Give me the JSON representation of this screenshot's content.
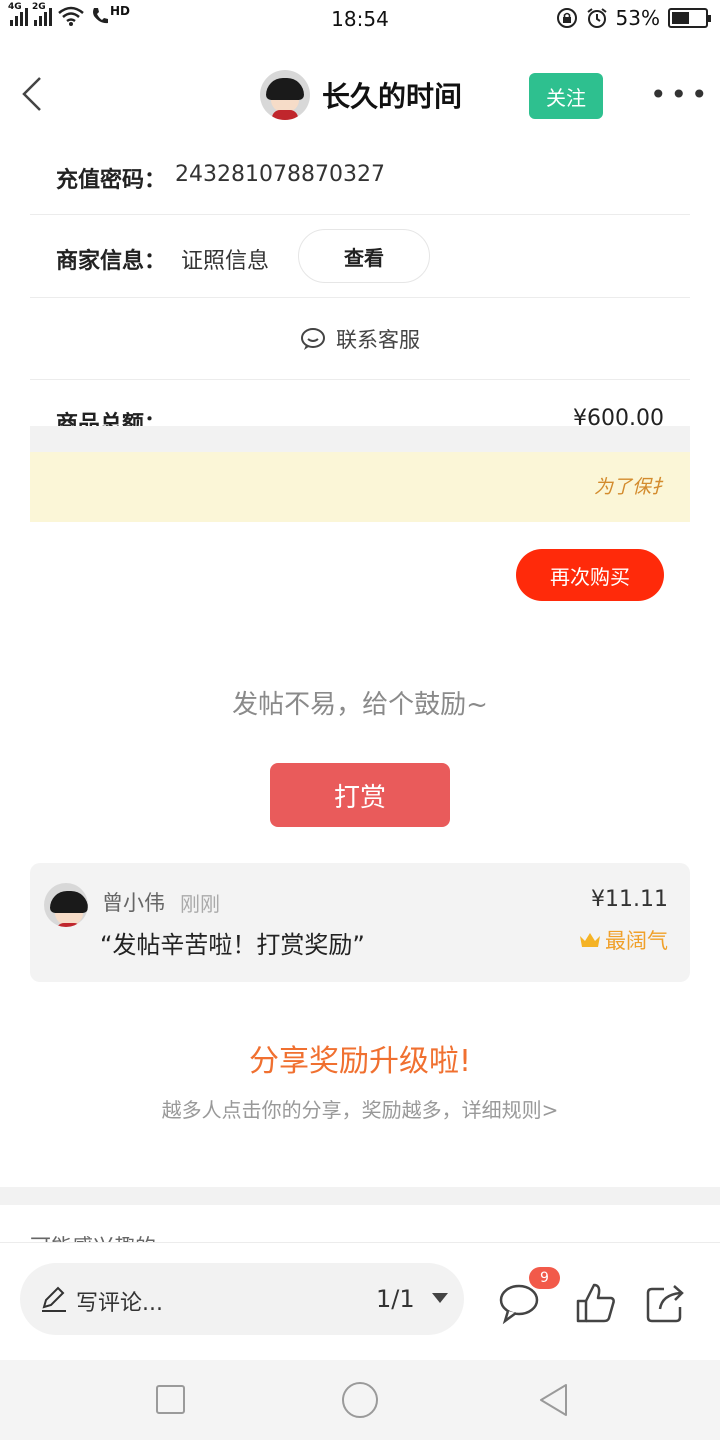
{
  "status_bar": {
    "net1": "4G",
    "net2": "2G",
    "hd": "HD",
    "time": "18:54",
    "battery_text": "53%",
    "battery_level": 0.53
  },
  "header": {
    "author_name": "长久的时间",
    "follow_label": "关注"
  },
  "order": {
    "recharge_label": "充值密码：",
    "recharge_value": "243281078870327",
    "merchant_label": "商家信息：",
    "merchant_value": "证照信息",
    "view_label": "查看",
    "service_label": "联系客服",
    "total_label": "商品总额：",
    "total_value": "¥600.00",
    "notice_text": "为了保扌",
    "rebuy_label": "再次购买"
  },
  "reward": {
    "prompt": "发帖不易，给个鼓励~",
    "button_label": "打赏",
    "tip": {
      "user": "曾小伟",
      "time": "刚刚",
      "message": "“发帖辛苦啦！打赏奖励”",
      "amount": "¥11.11",
      "badge": "最阔气"
    }
  },
  "share": {
    "title": "分享奖励升级啦!",
    "subtitle": "越多人点击你的分享，奖励越多，详细规则>"
  },
  "section": {
    "interest_title": "可能感兴趣的"
  },
  "bottom_bar": {
    "comment_placeholder": "写评论...",
    "page_indicator": "1/1",
    "comment_count": "9"
  },
  "colors": {
    "follow": "#2ec08f",
    "rebuy": "#ff2a0a",
    "tip_button": "#e95b5b",
    "share_title": "#f07030",
    "badge": "#f0a02a"
  }
}
